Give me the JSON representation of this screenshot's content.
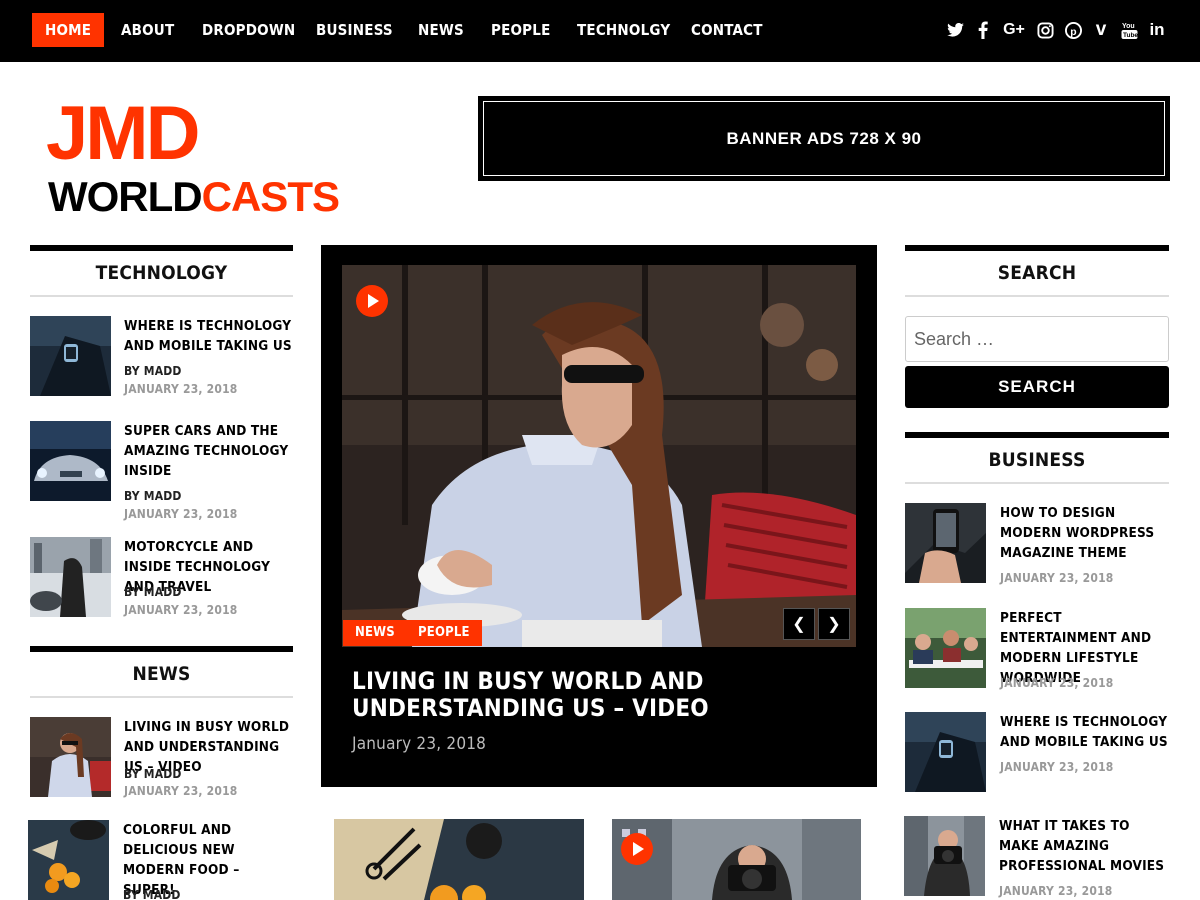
{
  "nav": {
    "items": [
      "HOME",
      "ABOUT",
      "DROPDOWN",
      "BUSINESS",
      "NEWS",
      "PEOPLE",
      "TECHNOLGY",
      "CONTACT"
    ],
    "social_icons": [
      "twitter-icon",
      "facebook-icon",
      "google-plus-icon",
      "instagram-icon",
      "pinterest-icon",
      "vimeo-icon",
      "youtube-icon",
      "linkedin-icon"
    ]
  },
  "logo": {
    "line1": "JMD",
    "line2_a": "WORLD",
    "line2_b": "CASTS"
  },
  "banner": {
    "text": "BANNER ADS 728 X 90"
  },
  "technology": {
    "title": "TECHNOLOGY",
    "posts": [
      {
        "title": "WHERE IS TECHNOLOGY AND MOBILE TAKING US",
        "by": "BY MADD",
        "date": "JANUARY 23, 2018"
      },
      {
        "title": "SUPER CARS AND THE AMAZING TECHNOLOGY INSIDE",
        "by": "BY MADD",
        "date": "JANUARY 23, 2018"
      },
      {
        "title": "MOTORCYCLE AND INSIDE TECHNOLOGY AND TRAVEL",
        "by": "BY MADD",
        "date": "JANUARY 23, 2018"
      }
    ]
  },
  "news": {
    "title": "NEWS",
    "posts": [
      {
        "title": "LIVING IN BUSY WORLD AND UNDERSTANDING US – VIDEO",
        "by": "BY MADD",
        "date": "JANUARY 23, 2018"
      },
      {
        "title": "COLORFUL AND DELICIOUS NEW MODERN FOOD – SUPER!",
        "by": "BY MADD"
      }
    ]
  },
  "feature": {
    "tags": [
      "NEWS",
      "PEOPLE"
    ],
    "title": "LIVING IN BUSY WORLD AND UNDERSTANDING US – VIDEO",
    "date": "January 23, 2018"
  },
  "search": {
    "title": "SEARCH",
    "placeholder": "Search …",
    "button": "SEARCH"
  },
  "business": {
    "title": "BUSINESS",
    "posts": [
      {
        "title": "HOW TO DESIGN MODERN WORDPRESS MAGAZINE THEME",
        "date": "JANUARY 23, 2018"
      },
      {
        "title": "PERFECT ENTERTAINMENT AND MODERN LIFESTYLE WORDWIDE",
        "date": "JANUARY 23, 2018"
      },
      {
        "title": "WHERE IS TECHNOLOGY AND MOBILE TAKING US",
        "date": "JANUARY 23, 2018"
      },
      {
        "title": "WHAT IT TAKES TO MAKE AMAZING PROFESSIONAL MOVIES",
        "date": "JANUARY 23, 2018"
      }
    ]
  },
  "colors": {
    "accent": "#ff3300",
    "dark": "#000000"
  }
}
